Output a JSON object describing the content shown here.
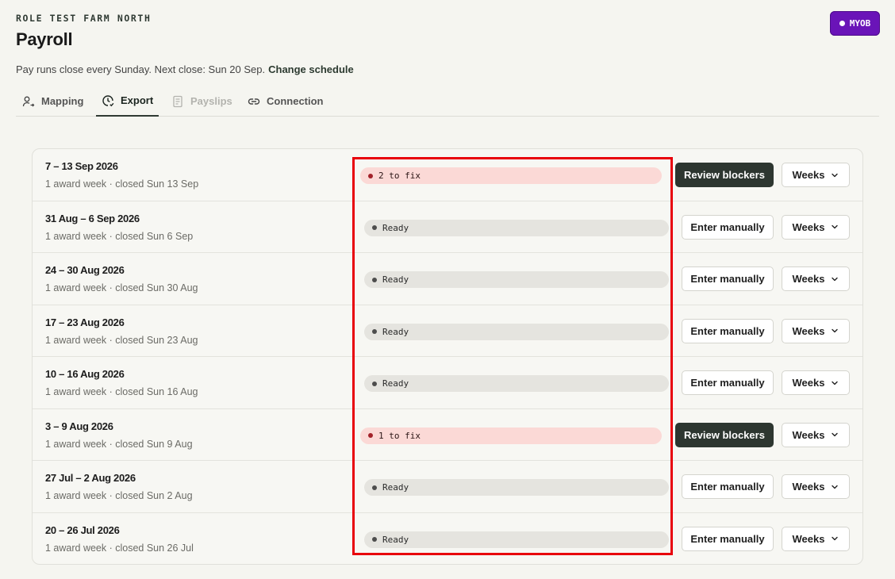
{
  "header": {
    "org_name": "ROLE TEST FARM NORTH",
    "title": "Payroll",
    "integration_badge": "MYOB",
    "schedule_text": "Pay runs close every Sunday. Next close: Sun 20 Sep.",
    "change_schedule_link": "Change schedule"
  },
  "tabs": [
    {
      "label": "Mapping",
      "icon": "user-arrow-icon",
      "state": "normal"
    },
    {
      "label": "Export",
      "icon": "clock-check-icon",
      "state": "active"
    },
    {
      "label": "Payslips",
      "icon": "document-icon",
      "state": "disabled"
    },
    {
      "label": "Connection",
      "icon": "link-icon",
      "state": "normal"
    }
  ],
  "pay_runs": [
    {
      "period": "7 – 13 Sep 2026",
      "meta": "1 award week · closed Sun 13 Sep",
      "status": "2 to fix",
      "status_type": "fix",
      "action": "Review blockers",
      "weeks_label": "Weeks"
    },
    {
      "period": "31 Aug – 6 Sep 2026",
      "meta": "1 award week · closed Sun 6 Sep",
      "status": "Ready",
      "status_type": "ready",
      "action": "Enter manually",
      "weeks_label": "Weeks"
    },
    {
      "period": "24 – 30 Aug 2026",
      "meta": "1 award week · closed Sun 30 Aug",
      "status": "Ready",
      "status_type": "ready",
      "action": "Enter manually",
      "weeks_label": "Weeks"
    },
    {
      "period": "17 – 23 Aug 2026",
      "meta": "1 award week · closed Sun 23 Aug",
      "status": "Ready",
      "status_type": "ready",
      "action": "Enter manually",
      "weeks_label": "Weeks"
    },
    {
      "period": "10 – 16 Aug 2026",
      "meta": "1 award week · closed Sun 16 Aug",
      "status": "Ready",
      "status_type": "ready",
      "action": "Enter manually",
      "weeks_label": "Weeks"
    },
    {
      "period": "3 – 9 Aug 2026",
      "meta": "1 award week · closed Sun 9 Aug",
      "status": "1 to fix",
      "status_type": "fix",
      "action": "Review blockers",
      "weeks_label": "Weeks"
    },
    {
      "period": "27 Jul – 2 Aug 2026",
      "meta": "1 award week · closed Sun 2 Aug",
      "status": "Ready",
      "status_type": "ready",
      "action": "Enter manually",
      "weeks_label": "Weeks"
    },
    {
      "period": "20 – 26 Jul 2026",
      "meta": "1 award week · closed Sun 26 Jul",
      "status": "Ready",
      "status_type": "ready",
      "action": "Enter manually",
      "weeks_label": "Weeks"
    }
  ],
  "colors": {
    "myob_purple": "#6a14b8",
    "fix_bg": "#fbd9d6",
    "fix_dot": "#a3222a",
    "ready_bg": "#e5e4df",
    "primary_button": "#2d3630",
    "highlight": "#e8000b"
  }
}
